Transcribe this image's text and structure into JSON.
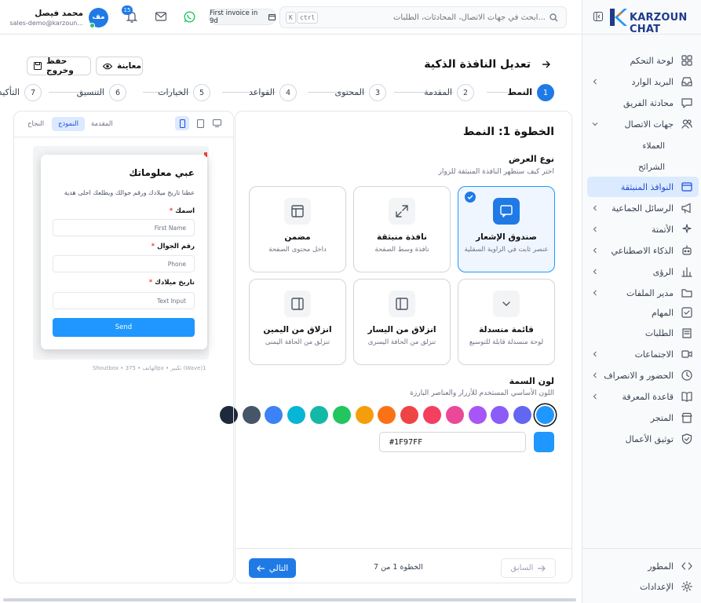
{
  "brand": {
    "name": "KARZOUN CHAT"
  },
  "sidebar": {
    "items": [
      {
        "label": "لوحة التحكم",
        "icon": "dashboard-icon",
        "chevron": false
      },
      {
        "label": "البريد الوارد",
        "icon": "inbox-icon",
        "chevron": true
      },
      {
        "label": "محادثة الفريق",
        "icon": "team-chat-icon",
        "chevron": false
      },
      {
        "label": "جهات الاتصال",
        "icon": "contacts-icon",
        "chevron": true,
        "expanded": true
      },
      {
        "label": "النوافذ المنبثقة",
        "icon": "popup-window-icon",
        "chevron": false,
        "active": true
      },
      {
        "label": "الرسائل الجماعية",
        "icon": "megaphone-icon",
        "chevron": true
      },
      {
        "label": "الأتمتة",
        "icon": "sparkles-icon",
        "chevron": true
      },
      {
        "label": "الذكاء الاصطناعي",
        "icon": "robot-icon",
        "chevron": true
      },
      {
        "label": "الرؤى",
        "icon": "bar-chart-icon",
        "chevron": true
      },
      {
        "label": "مدير الملفات",
        "icon": "folder-icon",
        "chevron": true
      },
      {
        "label": "المهام",
        "icon": "task-icon",
        "chevron": false
      },
      {
        "label": "الطلبات",
        "icon": "orders-icon",
        "chevron": false
      },
      {
        "label": "الاجتماعات",
        "icon": "video-icon",
        "chevron": true
      },
      {
        "label": "الحضور و الانصراف",
        "icon": "clock-icon",
        "chevron": true
      },
      {
        "label": "قاعدة المعرفة",
        "icon": "book-icon",
        "chevron": true
      },
      {
        "label": "المتجر",
        "icon": "store-icon",
        "chevron": false
      },
      {
        "label": "توثيق الأعمال",
        "icon": "shield-check-icon",
        "chevron": false
      }
    ],
    "subitems": [
      "العملاء",
      "الشرائح"
    ],
    "bottom": [
      {
        "label": "المطور",
        "icon": "code-icon"
      },
      {
        "label": "الإعدادات",
        "icon": "gear-icon"
      }
    ]
  },
  "topbar": {
    "search_placeholder": "ابحث في جهات الاتصال، المحادثات، الطلبات...",
    "kbd": [
      "ctrl",
      "K"
    ],
    "invoice_pill": "First invoice in 9d",
    "notif_count": "15",
    "user": {
      "name": "محمد فيصل",
      "email": "sales-demo@karzoun...",
      "initials": "مف"
    }
  },
  "page": {
    "title": "تعديل النافذة الذكية",
    "preview_label": "معاينة",
    "save_label": "حفظ وخروج"
  },
  "steps": [
    {
      "num": "1",
      "label": "النمط",
      "active": true
    },
    {
      "num": "2",
      "label": "المقدمة"
    },
    {
      "num": "3",
      "label": "المحتوى"
    },
    {
      "num": "4",
      "label": "القواعد"
    },
    {
      "num": "5",
      "label": "الخيارات"
    },
    {
      "num": "6",
      "label": "التنسيق"
    },
    {
      "num": "7",
      "label": "التأكيد"
    }
  ],
  "form": {
    "heading": "الخطوة 1: النمط",
    "display_type": {
      "title": "نوع العرض",
      "desc": "اختر كيف ستظهر النافذة المنبثقة للزوار"
    },
    "cards": [
      {
        "title": "صندوق الإشعار",
        "desc": "عنصر ثابت في الزاوية السفلية",
        "icon": "message-box-icon",
        "selected": true
      },
      {
        "title": "نافذة منبثقة",
        "desc": "نافذة وسط الصفحة",
        "icon": "expand-icon"
      },
      {
        "title": "مضمن",
        "desc": "داخل محتوى الصفحة",
        "icon": "embed-layout-icon"
      },
      {
        "title": "قائمة منسدلة",
        "desc": "لوحة منسدلة قابلة للتوسيع",
        "icon": "chevron-down-icon"
      },
      {
        "title": "انزلاق من اليسار",
        "desc": "تنزلق من الحافة اليسرى",
        "icon": "slide-left-icon"
      },
      {
        "title": "انزلاق من اليمين",
        "desc": "تنزلق من الحافة اليمنى",
        "icon": "slide-right-icon"
      }
    ],
    "theme": {
      "title": "لون السمة",
      "desc": "اللون الأساسي المستخدم للأزرار والعناصر البارزة",
      "value": "#1F97FF",
      "colors": [
        "#1f97ff",
        "#6366f1",
        "#8b5cf6",
        "#a855f7",
        "#ec4899",
        "#f43f5e",
        "#ef4444",
        "#f97316",
        "#f59e0b",
        "#22c55e",
        "#14b8a6",
        "#06b6d4",
        "#3b82f6",
        "#475569",
        "#1e293b"
      ]
    }
  },
  "footer": {
    "prev": "السابق",
    "next": "التالي",
    "counter": "الخطوة 1 من 7"
  },
  "preview": {
    "tabs": [
      "المقدمة",
      "النموذج",
      "النجاح"
    ],
    "popup_title": "عبي معلوماتك",
    "popup_desc": "عطنا تاريخ ميلادك ورقم جوالك ويطلعك احلى هدية",
    "fields": [
      {
        "label": "اسمك",
        "placeholder": "First Name"
      },
      {
        "label": "رقم الجوال",
        "placeholder": "Phone"
      },
      {
        "label": "تاريخ ميلادك",
        "placeholder": "Text Input"
      }
    ],
    "send": "Send",
    "caption": "Shoutbox • الهاتف • 375px • تكبير (Wave)1"
  }
}
